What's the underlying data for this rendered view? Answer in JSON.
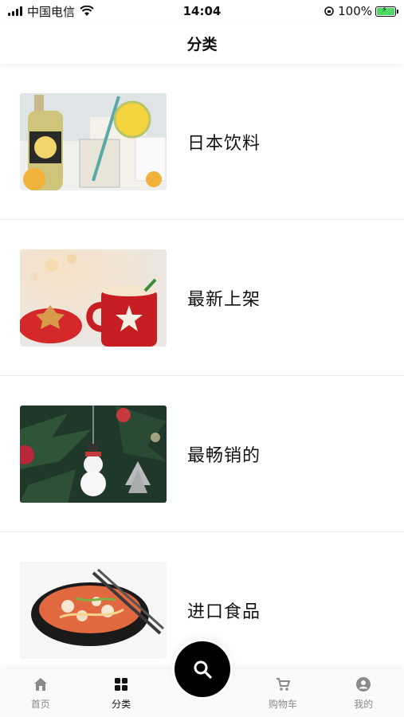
{
  "status_bar": {
    "carrier": "中国电信",
    "time": "14:04",
    "battery": "100%"
  },
  "nav": {
    "title": "分类"
  },
  "categories": [
    {
      "label": "日本饮料",
      "image": "japanese-drinks-image"
    },
    {
      "label": "最新上架",
      "image": "christmas-mug-image"
    },
    {
      "label": "最畅销的",
      "image": "christmas-tree-ornaments-image"
    },
    {
      "label": "进口食品",
      "image": "noodle-soup-bowl-image"
    }
  ],
  "tab_bar": {
    "items": [
      {
        "label": "首页",
        "icon": "home-icon"
      },
      {
        "label": "分类",
        "icon": "grid-icon"
      },
      {
        "label": "",
        "icon": "search-icon"
      },
      {
        "label": "购物车",
        "icon": "cart-icon"
      },
      {
        "label": "我的",
        "icon": "user-icon"
      }
    ],
    "active_index": 1,
    "active_color": "#111111",
    "inactive_color": "#8a8a8a"
  }
}
